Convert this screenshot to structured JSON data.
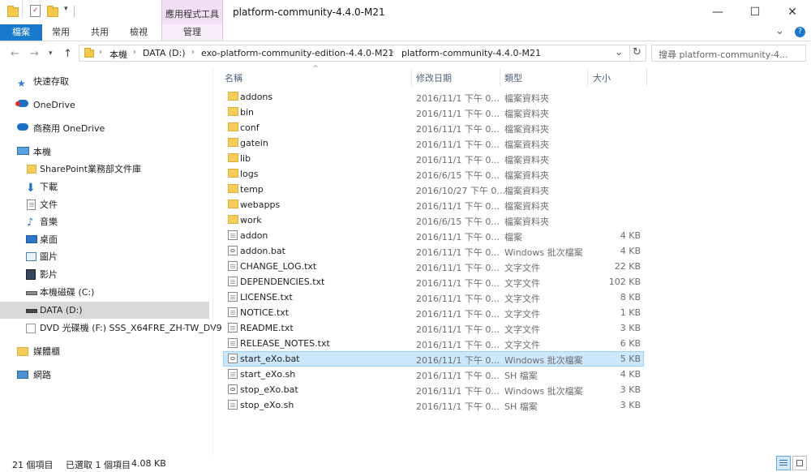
{
  "window": {
    "title": "platform-community-4.4.0-M21",
    "context_group_label": "應用程式工具",
    "minimize_glyph": "—",
    "maximize_glyph": "☐",
    "close_glyph": "✕"
  },
  "ribbon": {
    "tabs": [
      {
        "label": "檔案",
        "active": true
      },
      {
        "label": "常用"
      },
      {
        "label": "共用"
      },
      {
        "label": "檢視"
      },
      {
        "label": "管理"
      }
    ],
    "expand_glyph": "⌄",
    "help_glyph": "?"
  },
  "address": {
    "breadcrumb": [
      "本機",
      "DATA (D:)",
      "exo-platform-community-edition-4.4.0-M21",
      "platform-community-4.4.0-M21"
    ],
    "dropdown_glyph": "⌄",
    "refresh_glyph": "↻",
    "search_placeholder": "搜尋 platform-community-4..."
  },
  "navpane": {
    "items": [
      {
        "label": "快速存取",
        "icon": "star-icon"
      },
      {
        "label": "OneDrive",
        "icon": "cloud-icon"
      },
      {
        "label": "商務用 OneDrive",
        "icon": "cloud-icon"
      },
      {
        "label": "本機",
        "icon": "computer-icon"
      },
      {
        "label": "SharePoint業務部文件庫",
        "icon": "folder-icon"
      },
      {
        "label": "下載",
        "icon": "download-icon"
      },
      {
        "label": "文件",
        "icon": "document-icon"
      },
      {
        "label": "音樂",
        "icon": "music-icon"
      },
      {
        "label": "桌面",
        "icon": "desktop-icon"
      },
      {
        "label": "圖片",
        "icon": "picture-icon"
      },
      {
        "label": "影片",
        "icon": "video-icon"
      },
      {
        "label": "本機磁碟 (C:)",
        "icon": "drive-icon"
      },
      {
        "label": "DATA (D:)",
        "icon": "drive-icon",
        "selected": true
      },
      {
        "label": "DVD 光碟機 (F:) SSS_X64FRE_ZH-TW_DV9",
        "icon": "dvd-icon"
      },
      {
        "label": "媒體櫃",
        "icon": "library-icon"
      },
      {
        "label": "網路",
        "icon": "network-icon"
      }
    ]
  },
  "columns": {
    "name": "名稱",
    "date": "修改日期",
    "type": "類型",
    "size": "大小",
    "sort_glyph": "^"
  },
  "files": [
    {
      "name": "addons",
      "date": "2016/11/1 下午 0...",
      "type": "檔案資料夾",
      "size": "",
      "kind": "folder"
    },
    {
      "name": "bin",
      "date": "2016/11/1 下午 0...",
      "type": "檔案資料夾",
      "size": "",
      "kind": "folder"
    },
    {
      "name": "conf",
      "date": "2016/11/1 下午 0...",
      "type": "檔案資料夾",
      "size": "",
      "kind": "folder"
    },
    {
      "name": "gatein",
      "date": "2016/11/1 下午 0...",
      "type": "檔案資料夾",
      "size": "",
      "kind": "folder"
    },
    {
      "name": "lib",
      "date": "2016/11/1 下午 0...",
      "type": "檔案資料夾",
      "size": "",
      "kind": "folder"
    },
    {
      "name": "logs",
      "date": "2016/6/15 下午 0...",
      "type": "檔案資料夾",
      "size": "",
      "kind": "folder"
    },
    {
      "name": "temp",
      "date": "2016/10/27 下午 0...",
      "type": "檔案資料夾",
      "size": "",
      "kind": "folder"
    },
    {
      "name": "webapps",
      "date": "2016/11/1 下午 0...",
      "type": "檔案資料夾",
      "size": "",
      "kind": "folder"
    },
    {
      "name": "work",
      "date": "2016/6/15 下午 0...",
      "type": "檔案資料夾",
      "size": "",
      "kind": "folder"
    },
    {
      "name": "addon",
      "date": "2016/11/1 下午 0...",
      "type": "檔案",
      "size": "4 KB",
      "kind": "doc"
    },
    {
      "name": "addon.bat",
      "date": "2016/11/1 下午 0...",
      "type": "Windows 批次檔案",
      "size": "4 KB",
      "kind": "bat"
    },
    {
      "name": "CHANGE_LOG.txt",
      "date": "2016/11/1 下午 0...",
      "type": "文字文件",
      "size": "22 KB",
      "kind": "doc"
    },
    {
      "name": "DEPENDENCIES.txt",
      "date": "2016/11/1 下午 0...",
      "type": "文字文件",
      "size": "102 KB",
      "kind": "doc"
    },
    {
      "name": "LICENSE.txt",
      "date": "2016/11/1 下午 0...",
      "type": "文字文件",
      "size": "8 KB",
      "kind": "doc"
    },
    {
      "name": "NOTICE.txt",
      "date": "2016/11/1 下午 0...",
      "type": "文字文件",
      "size": "1 KB",
      "kind": "doc"
    },
    {
      "name": "README.txt",
      "date": "2016/11/1 下午 0...",
      "type": "文字文件",
      "size": "3 KB",
      "kind": "doc"
    },
    {
      "name": "RELEASE_NOTES.txt",
      "date": "2016/11/1 下午 0...",
      "type": "文字文件",
      "size": "6 KB",
      "kind": "doc"
    },
    {
      "name": "start_eXo.bat",
      "date": "2016/11/1 下午 0...",
      "type": "Windows 批次檔案",
      "size": "5 KB",
      "kind": "bat",
      "selected": true
    },
    {
      "name": "start_eXo.sh",
      "date": "2016/11/1 下午 0...",
      "type": "SH 檔案",
      "size": "4 KB",
      "kind": "doc"
    },
    {
      "name": "stop_eXo.bat",
      "date": "2016/11/1 下午 0...",
      "type": "Windows 批次檔案",
      "size": "3 KB",
      "kind": "bat"
    },
    {
      "name": "stop_eXo.sh",
      "date": "2016/11/1 下午 0...",
      "type": "SH 檔案",
      "size": "3 KB",
      "kind": "doc"
    }
  ],
  "status": {
    "item_count": "21 個項目",
    "selection": "已選取 1 個項目",
    "selection_size": "4.08 KB"
  },
  "colors": {
    "accent": "#1979ca",
    "context_tab": "#f3dff5",
    "selection_bg": "#cce8ff",
    "selection_border": "#99d1ff",
    "folder": "#f6cc5a"
  }
}
